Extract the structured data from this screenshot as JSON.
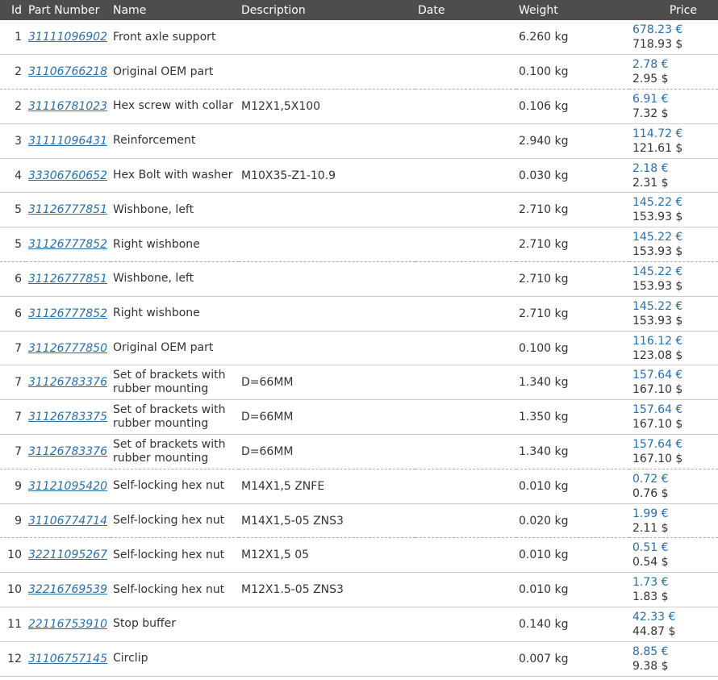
{
  "table": {
    "headers": {
      "id": "Id",
      "part_number": "Part Number",
      "name": "Name",
      "description": "Description",
      "date": "Date",
      "weight": "Weight",
      "price": "Price"
    },
    "colors": {
      "header_bg": "#4d4d4d",
      "link": "#2a6fa8",
      "text": "#333333"
    },
    "rows": [
      {
        "id": "1",
        "part_number": "31111096902",
        "name": "Front axle support",
        "description": "",
        "date": "",
        "weight": "6.260 kg",
        "price_eur": "678.23 €",
        "price_usd": "718.93 $"
      },
      {
        "id": "2",
        "part_number": "31106766218",
        "name": "Original OEM part",
        "description": "",
        "date": "",
        "weight": "0.100 kg",
        "price_eur": "2.78 €",
        "price_usd": "2.95 $"
      },
      {
        "id": "2",
        "part_number": "31116781023",
        "name": "Hex screw with collar",
        "description": "M12X1,5X100",
        "date": "",
        "weight": "0.106 kg",
        "price_eur": "6.91 €",
        "price_usd": "7.32 $"
      },
      {
        "id": "3",
        "part_number": "31111096431",
        "name": "Reinforcement",
        "description": "",
        "date": "",
        "weight": "2.940 kg",
        "price_eur": "114.72 €",
        "price_usd": "121.61 $"
      },
      {
        "id": "4",
        "part_number": "33306760652",
        "name": "Hex Bolt with washer",
        "description": "M10X35-Z1-10.9",
        "date": "",
        "weight": "0.030 kg",
        "price_eur": "2.18 €",
        "price_usd": "2.31 $"
      },
      {
        "id": "5",
        "part_number": "31126777851",
        "name": "Wishbone, left",
        "description": "",
        "date": "",
        "weight": "2.710 kg",
        "price_eur": "145.22 €",
        "price_usd": "153.93 $"
      },
      {
        "id": "5",
        "part_number": "31126777852",
        "name": "Right wishbone",
        "description": "",
        "date": "",
        "weight": "2.710 kg",
        "price_eur": "145.22 €",
        "price_usd": "153.93 $"
      },
      {
        "id": "6",
        "part_number": "31126777851",
        "name": "Wishbone, left",
        "description": "",
        "date": "",
        "weight": "2.710 kg",
        "price_eur": "145.22 €",
        "price_usd": "153.93 $"
      },
      {
        "id": "6",
        "part_number": "31126777852",
        "name": "Right wishbone",
        "description": "",
        "date": "",
        "weight": "2.710 kg",
        "price_eur": "145.22 €",
        "price_usd": "153.93 $"
      },
      {
        "id": "7",
        "part_number": "31126777850",
        "name": "Original OEM part",
        "description": "",
        "date": "",
        "weight": "0.100 kg",
        "price_eur": "116.12 €",
        "price_usd": "123.08 $"
      },
      {
        "id": "7",
        "part_number": "31126783376",
        "name": "Set of brackets with rubber mounting",
        "description": "D=66MM",
        "date": "",
        "weight": "1.340 kg",
        "price_eur": "157.64 €",
        "price_usd": "167.10 $"
      },
      {
        "id": "7",
        "part_number": "31126783375",
        "name": "Set of brackets with rubber mounting",
        "description": "D=66MM",
        "date": "",
        "weight": "1.350 kg",
        "price_eur": "157.64 €",
        "price_usd": "167.10 $"
      },
      {
        "id": "7",
        "part_number": "31126783376",
        "name": "Set of brackets with rubber mounting",
        "description": "D=66MM",
        "date": "",
        "weight": "1.340 kg",
        "price_eur": "157.64 €",
        "price_usd": "167.10 $"
      },
      {
        "id": "9",
        "part_number": "31121095420",
        "name": "Self-locking hex nut",
        "description": "M14X1,5 ZNFE",
        "date": "",
        "weight": "0.010 kg",
        "price_eur": "0.72 €",
        "price_usd": "0.76 $"
      },
      {
        "id": "9",
        "part_number": "31106774714",
        "name": "Self-locking hex nut",
        "description": "M14X1,5-05 ZNS3",
        "date": "",
        "weight": "0.020 kg",
        "price_eur": "1.99 €",
        "price_usd": "2.11 $"
      },
      {
        "id": "10",
        "part_number": "32211095267",
        "name": "Self-locking hex nut",
        "description": "M12X1,5 05",
        "date": "",
        "weight": "0.010 kg",
        "price_eur": "0.51 €",
        "price_usd": "0.54 $"
      },
      {
        "id": "10",
        "part_number": "32216769539",
        "name": "Self-locking hex nut",
        "description": "M12X1.5-05 ZNS3",
        "date": "",
        "weight": "0.010 kg",
        "price_eur": "1.73 €",
        "price_usd": "1.83 $"
      },
      {
        "id": "11",
        "part_number": "22116753910",
        "name": "Stop buffer",
        "description": "",
        "date": "",
        "weight": "0.140 kg",
        "price_eur": "42.33 €",
        "price_usd": "44.87 $"
      },
      {
        "id": "12",
        "part_number": "31106757145",
        "name": "Circlip",
        "description": "",
        "date": "",
        "weight": "0.007 kg",
        "price_eur": "8.85 €",
        "price_usd": "9.38 $"
      }
    ]
  }
}
